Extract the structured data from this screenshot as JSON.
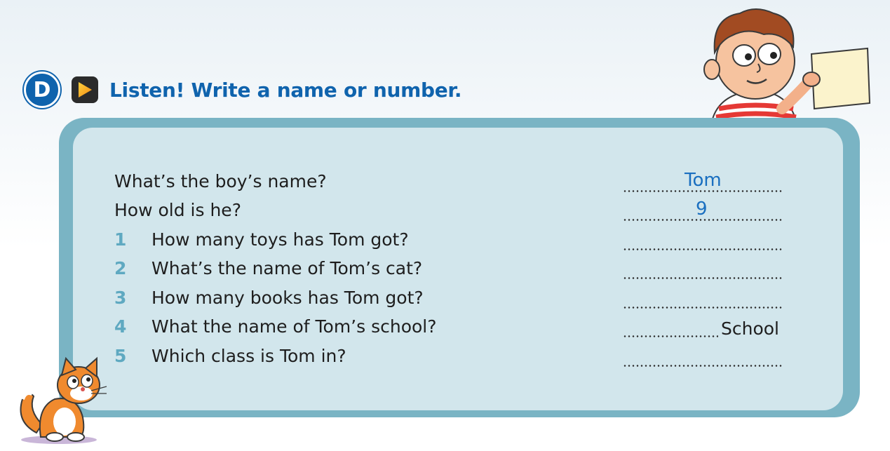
{
  "header": {
    "badge_letter": "D",
    "title": "Listen! Write a name or number."
  },
  "questions": [
    {
      "number": "",
      "text": "What’s the boy’s name?",
      "answer": "Tom",
      "suffix": ""
    },
    {
      "number": "",
      "text": "How old is he?",
      "answer": "9",
      "suffix": ""
    },
    {
      "number": "1",
      "text": "How many toys has Tom got?",
      "answer": "",
      "suffix": ""
    },
    {
      "number": "2",
      "text": "What’s the name of Tom’s cat?",
      "answer": "",
      "suffix": ""
    },
    {
      "number": "3",
      "text": "How many books has Tom got?",
      "answer": "",
      "suffix": ""
    },
    {
      "number": "4",
      "text": "What the name of Tom’s school?",
      "answer": "",
      "suffix": "School"
    },
    {
      "number": "5",
      "text": "Which class is Tom in?",
      "answer": "",
      "suffix": ""
    }
  ],
  "icons": {
    "badge": "letter-d-badge-icon",
    "audio": "play-icon",
    "boy": "boy-illustration",
    "cat": "cat-illustration"
  },
  "colors": {
    "title_blue": "#0f63ad",
    "number_blue": "#5fa9c1",
    "panel_border": "#7ab4c4",
    "panel_fill": "#d2e6ec",
    "handwriting": "#1a6fc0"
  }
}
